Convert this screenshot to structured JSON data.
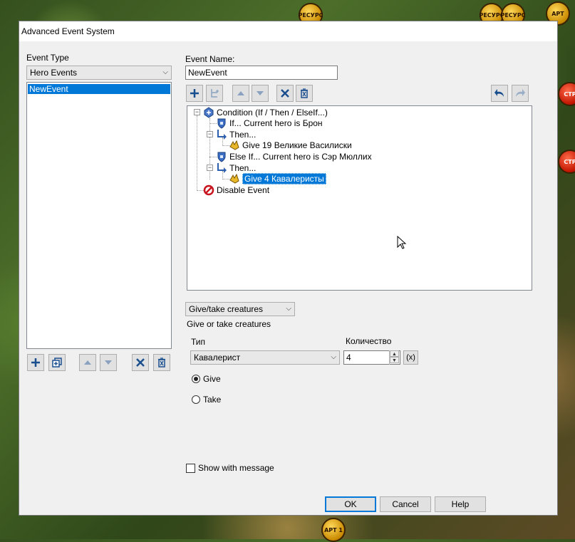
{
  "map": {
    "gems": [
      {
        "label": "РЕСУРС",
        "type": "gold"
      },
      {
        "label": "РЕСУРС",
        "type": "gold"
      },
      {
        "label": "РЕСУРС",
        "type": "gold"
      },
      {
        "label": "АРТ",
        "type": "gold"
      },
      {
        "label": "СТР",
        "type": "red"
      },
      {
        "label": "СТР",
        "type": "red"
      },
      {
        "label": "АРТ 1",
        "type": "gold"
      }
    ]
  },
  "dialog": {
    "title": "Advanced Event System",
    "event_type_label": "Event Type",
    "event_type_value": "Hero Events",
    "event_list": [
      "NewEvent"
    ],
    "event_name_label": "Event Name:",
    "event_name_value": "NewEvent",
    "tree": {
      "root": "Condition (If / Then / ElseIf...)",
      "if1": "If... Current hero is Брон",
      "then1": "Then...",
      "give1": "Give 19 Великие Василиски",
      "elseif": "Else If... Current hero is Сэр Мюллих",
      "then2": "Then...",
      "give2": "Give 4 Кавалеристы",
      "disable": "Disable Event"
    },
    "action_combo": "Give/take creatures",
    "action_desc": "Give or take creatures",
    "type_label": "Тип",
    "type_value": "Кавалерист",
    "qty_label": "Количество",
    "qty_value": "4",
    "expr_button": "(x)",
    "radio_give": "Give",
    "radio_take": "Take",
    "show_message": "Show with message",
    "ok": "OK",
    "cancel": "Cancel",
    "help": "Help"
  },
  "colors": {
    "selection": "#0078d7",
    "dialog_bg": "#f0f0f0"
  }
}
